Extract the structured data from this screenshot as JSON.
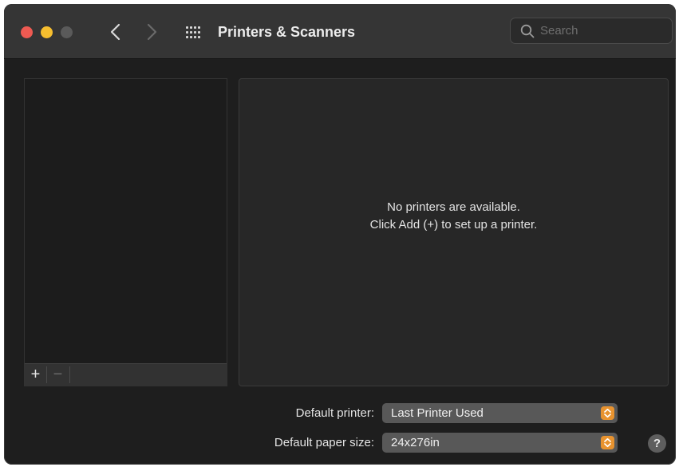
{
  "window": {
    "title": "Printers & Scanners",
    "traffic_lights": {
      "close_color": "#ee5a52",
      "minimize_color": "#f6be2f",
      "zoom_color": "#5a5a5a"
    },
    "nav": {
      "back_icon": "chevron-left-icon",
      "forward_icon": "chevron-right-icon",
      "grid_icon": "show-all-grid-icon"
    },
    "search": {
      "placeholder": "Search",
      "value": ""
    }
  },
  "printer_list": {
    "items": [],
    "toolbar": {
      "add_label": "+",
      "remove_label": "−"
    }
  },
  "detail": {
    "empty_line1": "No printers are available.",
    "empty_line2": "Click Add (+) to set up a printer."
  },
  "settings": {
    "default_printer": {
      "label": "Default printer:",
      "value": "Last Printer Used"
    },
    "paper_size": {
      "label": "Default paper size:",
      "value": "24x276in"
    }
  },
  "help": {
    "label": "?"
  },
  "colors": {
    "accent": "#e8932f",
    "window_bg": "#1e1e1e",
    "titlebar_bg": "#353535"
  }
}
